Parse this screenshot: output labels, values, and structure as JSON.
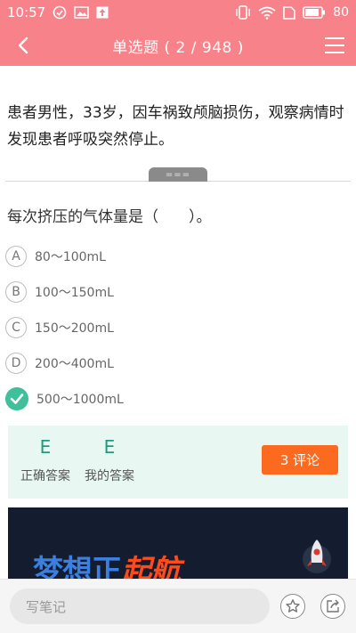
{
  "status_bar": {
    "time": "10:57",
    "battery": "80"
  },
  "nav": {
    "title": "单选题 ( 2 / 948 )"
  },
  "question": {
    "stem": "患者男性，33岁，因车祸致颅脑损伤，观察病情时发现患者呼吸突然停止。",
    "drag_handle": "===",
    "text": "每次挤压的气体量是（　　）。",
    "options": [
      {
        "letter": "A",
        "text": "80～100mL"
      },
      {
        "letter": "B",
        "text": "100～150mL"
      },
      {
        "letter": "C",
        "text": "150～200mL"
      },
      {
        "letter": "D",
        "text": "200～400mL"
      },
      {
        "letter": "E",
        "text": "500～1000mL",
        "selected": true
      }
    ]
  },
  "answer": {
    "correct_value": "E",
    "correct_label": "正确答案",
    "mine_value": "E",
    "mine_label": "我的答案",
    "comment_button": "3 评论"
  },
  "banner": {
    "text_part1": "梦想正",
    "text_part2": "起航"
  },
  "bottom_bar": {
    "note_placeholder": "写笔记"
  },
  "colors": {
    "header": "#f8828a",
    "correct": "#3fbf9a",
    "comment": "#fb6a1e"
  }
}
